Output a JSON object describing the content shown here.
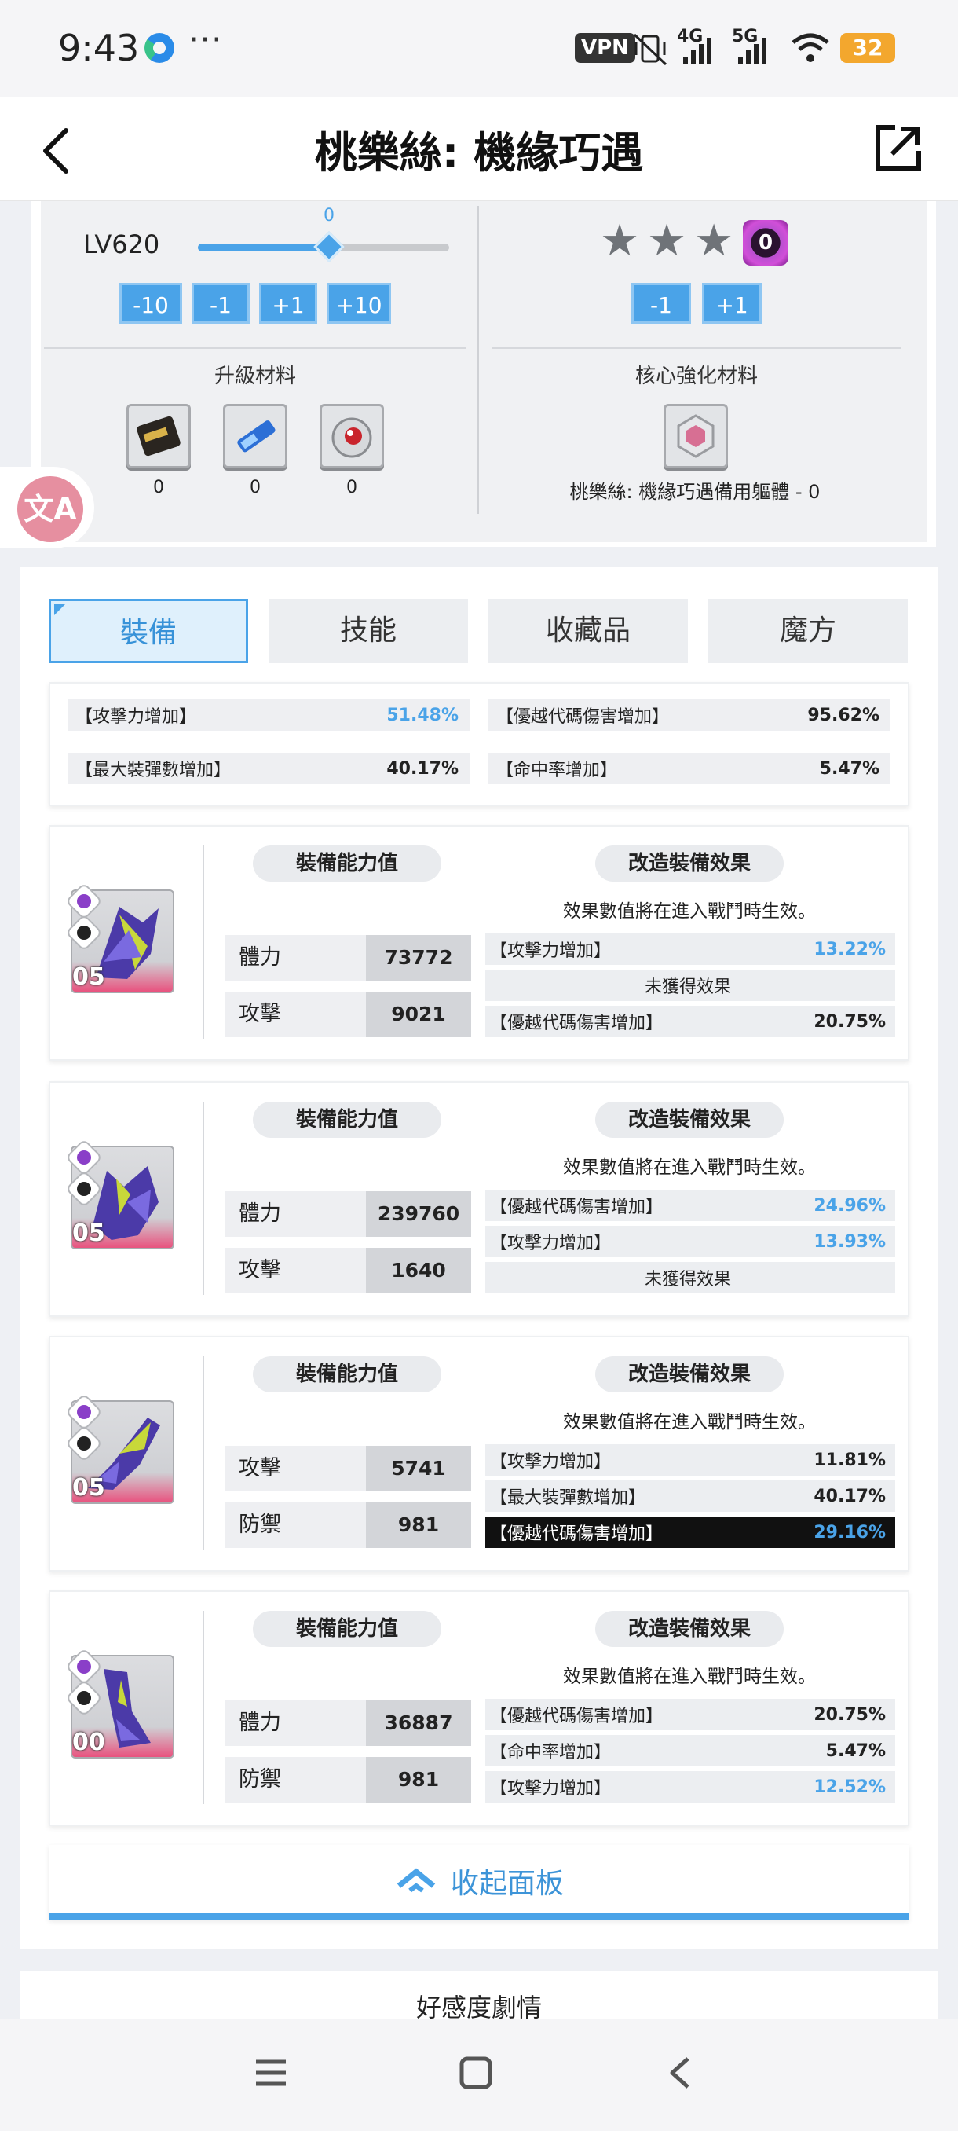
{
  "status_bar": {
    "time": "9:43",
    "more": "···",
    "vpn": "VPN",
    "net1": "4G",
    "net2": "5G",
    "battery": "32"
  },
  "header": {
    "title": "桃樂絲: 機緣巧遇"
  },
  "upgrade": {
    "level_label": "LV620",
    "slider_value": "0",
    "slider_fraction": 0.5,
    "buttons": [
      "-10",
      "-1",
      "+1",
      "+10"
    ],
    "materials_title": "升級材料",
    "materials": [
      {
        "icon": "scroll-material-icon",
        "count": "0"
      },
      {
        "icon": "data-drive-material-icon",
        "count": "0"
      },
      {
        "icon": "red-core-material-icon",
        "count": "0"
      }
    ]
  },
  "core": {
    "stars": 3,
    "level": "0",
    "buttons": [
      "-1",
      "+1"
    ],
    "materials_title": "核心強化材料",
    "material_icon": "spare-body-icon",
    "caption": "桃樂絲: 機緣巧遇備用軀體 - 0"
  },
  "tabs": [
    "裝備",
    "技能",
    "收藏品",
    "魔方"
  ],
  "summary": [
    {
      "label": "【攻擊力增加】",
      "value": "51.48%",
      "highlight": true
    },
    {
      "label": "【優越代碼傷害增加】",
      "value": "95.62%",
      "highlight": false
    },
    {
      "label": "【最大裝彈數增加】",
      "value": "40.17%",
      "highlight": false
    },
    {
      "label": "【命中率增加】",
      "value": "5.47%",
      "highlight": false
    }
  ],
  "equip_headers": {
    "ability": "裝備能力值",
    "effect": "改造裝備效果",
    "hint": "效果數值將在進入戰鬥時生效。"
  },
  "equipment": [
    {
      "level": "05",
      "stats": [
        {
          "label": "體力",
          "value": "73772"
        },
        {
          "label": "攻擊",
          "value": "9021"
        }
      ],
      "effects": [
        {
          "label": "【攻擊力增加】",
          "value": "13.22%",
          "highlight": true
        },
        {
          "label": "未獲得效果",
          "value": "",
          "empty": true
        },
        {
          "label": "【優越代碼傷害增加】",
          "value": "20.75%",
          "highlight": false
        }
      ]
    },
    {
      "level": "05",
      "stats": [
        {
          "label": "體力",
          "value": "239760"
        },
        {
          "label": "攻擊",
          "value": "1640"
        }
      ],
      "effects": [
        {
          "label": "【優越代碼傷害增加】",
          "value": "24.96%",
          "highlight": true
        },
        {
          "label": "【攻擊力增加】",
          "value": "13.93%",
          "highlight": true
        },
        {
          "label": "未獲得效果",
          "value": "",
          "empty": true
        }
      ]
    },
    {
      "level": "05",
      "stats": [
        {
          "label": "攻擊",
          "value": "5741"
        },
        {
          "label": "防禦",
          "value": "981"
        }
      ],
      "effects": [
        {
          "label": "【攻擊力增加】",
          "value": "11.81%",
          "highlight": false
        },
        {
          "label": "【最大裝彈數增加】",
          "value": "40.17%",
          "highlight": false
        },
        {
          "label": "【優越代碼傷害增加】",
          "value": "29.16%",
          "highlight": true,
          "dark": true
        }
      ]
    },
    {
      "level": "00",
      "stats": [
        {
          "label": "體力",
          "value": "36887"
        },
        {
          "label": "防禦",
          "value": "981"
        }
      ],
      "effects": [
        {
          "label": "【優越代碼傷害增加】",
          "value": "20.75%",
          "highlight": false
        },
        {
          "label": "【命中率增加】",
          "value": "5.47%",
          "highlight": false
        },
        {
          "label": "【攻擊力增加】",
          "value": "12.52%",
          "highlight": true
        }
      ]
    }
  ],
  "collapse": {
    "label": "收起面板"
  },
  "affinity": {
    "label": "好感度劇情"
  },
  "colors": {
    "accent": "#4aa3e8",
    "battery": "#f3a72e",
    "core_purple": "#b84fd0"
  }
}
